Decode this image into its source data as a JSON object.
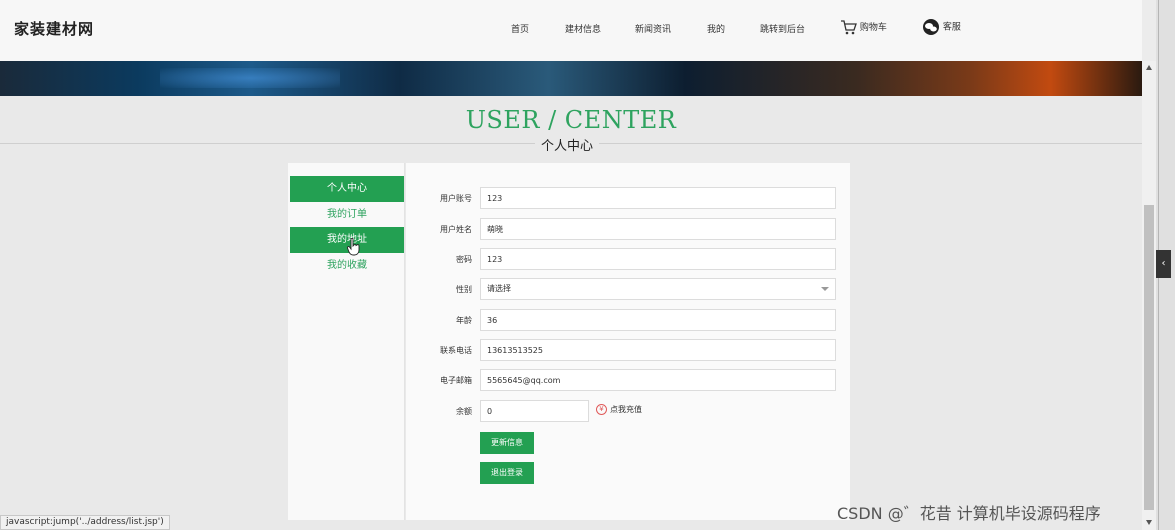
{
  "header": {
    "logo": "家装建材网",
    "nav": [
      {
        "label": "首页",
        "icon": ""
      },
      {
        "label": "建材信息",
        "icon": ""
      },
      {
        "label": "新闻资讯",
        "icon": ""
      },
      {
        "label": "我的",
        "icon": ""
      },
      {
        "label": "跳转到后台",
        "icon": ""
      },
      {
        "label": "购物车",
        "icon": "cart-icon"
      },
      {
        "label": "客服",
        "icon": "chat-icon"
      }
    ]
  },
  "title": {
    "en": "USER / CENTER",
    "cn": "个人中心"
  },
  "sidebar": {
    "items": [
      {
        "label": "个人中心",
        "active": true
      },
      {
        "label": "我的订单",
        "active": false
      },
      {
        "label": "我的地址",
        "active": true
      },
      {
        "label": "我的收藏",
        "active": false
      }
    ]
  },
  "form": {
    "fields": [
      {
        "label": "用户账号",
        "value": "123",
        "type": "text"
      },
      {
        "label": "用户姓名",
        "value": "萌晓",
        "type": "text"
      },
      {
        "label": "密码",
        "value": "123",
        "type": "text"
      },
      {
        "label": "性别",
        "value": "请选择",
        "type": "select"
      },
      {
        "label": "年龄",
        "value": "36",
        "type": "text"
      },
      {
        "label": "联系电话",
        "value": "13613513525",
        "type": "text"
      },
      {
        "label": "电子邮箱",
        "value": "5565645@qq.com",
        "type": "text"
      },
      {
        "label": "余额",
        "value": "0",
        "type": "short"
      }
    ],
    "recharge_label": "点我充值",
    "update_button": "更新信息",
    "logout_button": "退出登录"
  },
  "status_bar": "javascript:jump('../address/list.jsp')",
  "watermark": "CSDN @゛花昔  计算机毕设源码程序",
  "colors": {
    "accent": "#23a052",
    "title_green": "#2ea35f"
  }
}
